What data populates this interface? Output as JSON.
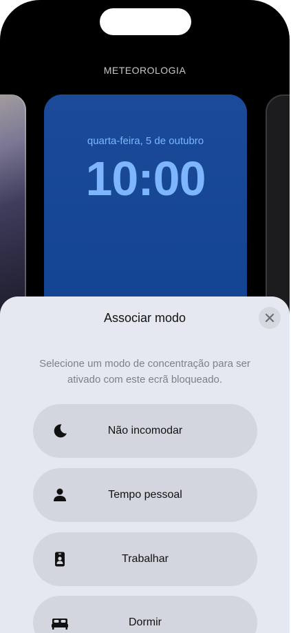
{
  "lockscreen": {
    "section_label": "METEOROLOGIA",
    "date": "quarta-feira, 5 de outubro",
    "time": "10:00"
  },
  "sheet": {
    "title": "Associar modo",
    "subtitle": "Selecione um modo de concentração para ser ativado com este ecrã bloqueado.",
    "modes": [
      {
        "label": "Não incomodar",
        "icon": "moon-icon"
      },
      {
        "label": "Tempo pessoal",
        "icon": "person-icon"
      },
      {
        "label": "Trabalhar",
        "icon": "id-badge-icon"
      },
      {
        "label": "Dormir",
        "icon": "bed-icon"
      }
    ]
  }
}
